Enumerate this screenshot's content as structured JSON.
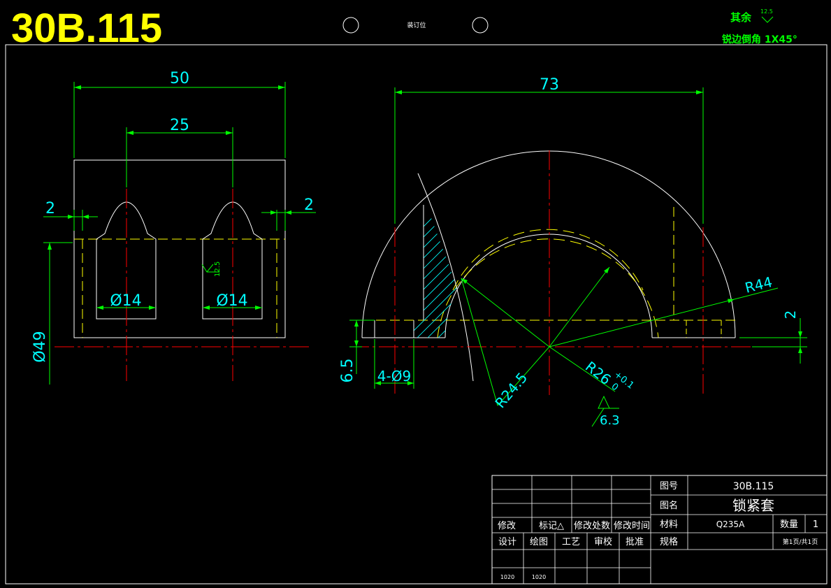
{
  "header": {
    "drawing_code": "30B.115",
    "binding_label": "装订位",
    "roughness_note_prefix": "其余",
    "roughness_note_value": "12.5",
    "chamfer_note": "锐边倒角 1X45°"
  },
  "left_view": {
    "dims": {
      "overall_width": "50",
      "hole_spacing": "25",
      "left_offset": "2",
      "right_offset": "2",
      "hole_left_dia": "Ø14",
      "hole_right_dia": "Ø14",
      "outer_dia": "Ø49",
      "roughness": "12.5"
    }
  },
  "right_view": {
    "dims": {
      "overall_width": "73",
      "outer_radius": "R44",
      "inner_radius": "R24.5",
      "bore_radius": "R26",
      "bore_tol_upper": "+0.1",
      "bore_tol_lower": "0",
      "step_height": "2",
      "base_height": "6.5",
      "holes": "4-Ø9",
      "roughness": "6.3"
    }
  },
  "title_block": {
    "code_label": "图号",
    "code_value": "30B.115",
    "name_label": "图名",
    "name_value": "锁紧套",
    "material_label": "材料",
    "material_value": "Q235A",
    "qty_label": "数量",
    "qty_value": "1",
    "spec_label": "规格",
    "page_value": "第1页/共1页",
    "rev_headers": [
      "修改",
      "标记△",
      "修改处数",
      "修改时间"
    ],
    "sign_headers": [
      "设计",
      "绘图",
      "工艺",
      "审校",
      "批准"
    ],
    "sign_values": [
      "1020",
      "1020"
    ]
  },
  "colors": {
    "outline": "#ffffff",
    "dimension": "#00ff00",
    "dim_text": "#00ffff",
    "center": "#ff0000",
    "hidden": "#ffff00",
    "title": "#ffff00",
    "hatch": "#00ffff"
  }
}
